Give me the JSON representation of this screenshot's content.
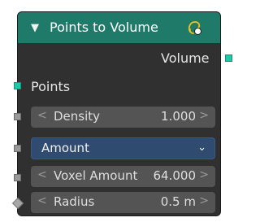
{
  "node": {
    "title": "Points to Volume",
    "collapse_icon": "▼",
    "header_color": "#1f7a69",
    "output": {
      "label": "Volume"
    },
    "inputs": {
      "points_label": "Points",
      "density": {
        "label": "Density",
        "value": "1.000"
      },
      "resolution_mode": {
        "selected": "Amount"
      },
      "voxel_amount": {
        "label": "Voxel Amount",
        "value": "64.000"
      },
      "radius": {
        "label": "Radius",
        "value": "0.5 m"
      }
    },
    "arrows": {
      "left": "<",
      "right": ">"
    },
    "chevron": "⌄"
  },
  "colors": {
    "geometry_socket": "#21c8a8",
    "float_socket": "#9a9a9a",
    "dropdown_bg": "#2f4b6f"
  },
  "icons": [
    "collapse-triangle-icon",
    "field-badge-icon",
    "chevron-down-icon"
  ]
}
